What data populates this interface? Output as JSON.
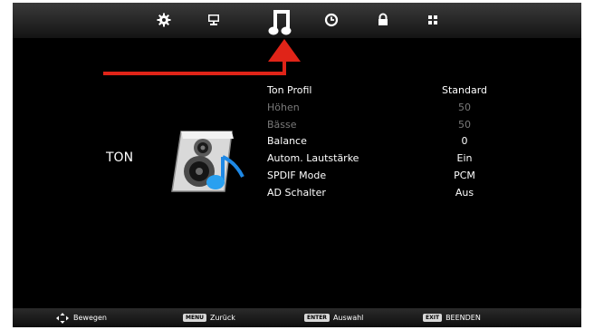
{
  "topbar": {
    "icons": [
      "settings-gear-icon",
      "monitor-icon",
      "music-note-icon",
      "clock-icon",
      "lock-icon",
      "grid-apps-icon"
    ],
    "active": "music-note-icon"
  },
  "section": {
    "title": "TON"
  },
  "settings": [
    {
      "label": "Ton Profil",
      "value": "Standard",
      "enabled": true
    },
    {
      "label": "Höhen",
      "value": "50",
      "enabled": false
    },
    {
      "label": "Bässe",
      "value": "50",
      "enabled": false
    },
    {
      "label": "Balance",
      "value": "0",
      "enabled": true
    },
    {
      "label": "Autom. Lautstärke",
      "value": "Ein",
      "enabled": true
    },
    {
      "label": "SPDIF Mode",
      "value": "PCM",
      "enabled": true
    },
    {
      "label": "AD Schalter",
      "value": "Aus",
      "enabled": true
    }
  ],
  "footer": {
    "move": "Bewegen",
    "menu_key": "MENU",
    "menu": "Zurück",
    "enter_key": "ENTER",
    "enter": "Auswahl",
    "exit_key": "EXIT",
    "exit": "BEENDEN"
  },
  "colors": {
    "accent_arrow": "#e02418",
    "background": "#000000",
    "disabled_text": "#7a7a7a"
  }
}
